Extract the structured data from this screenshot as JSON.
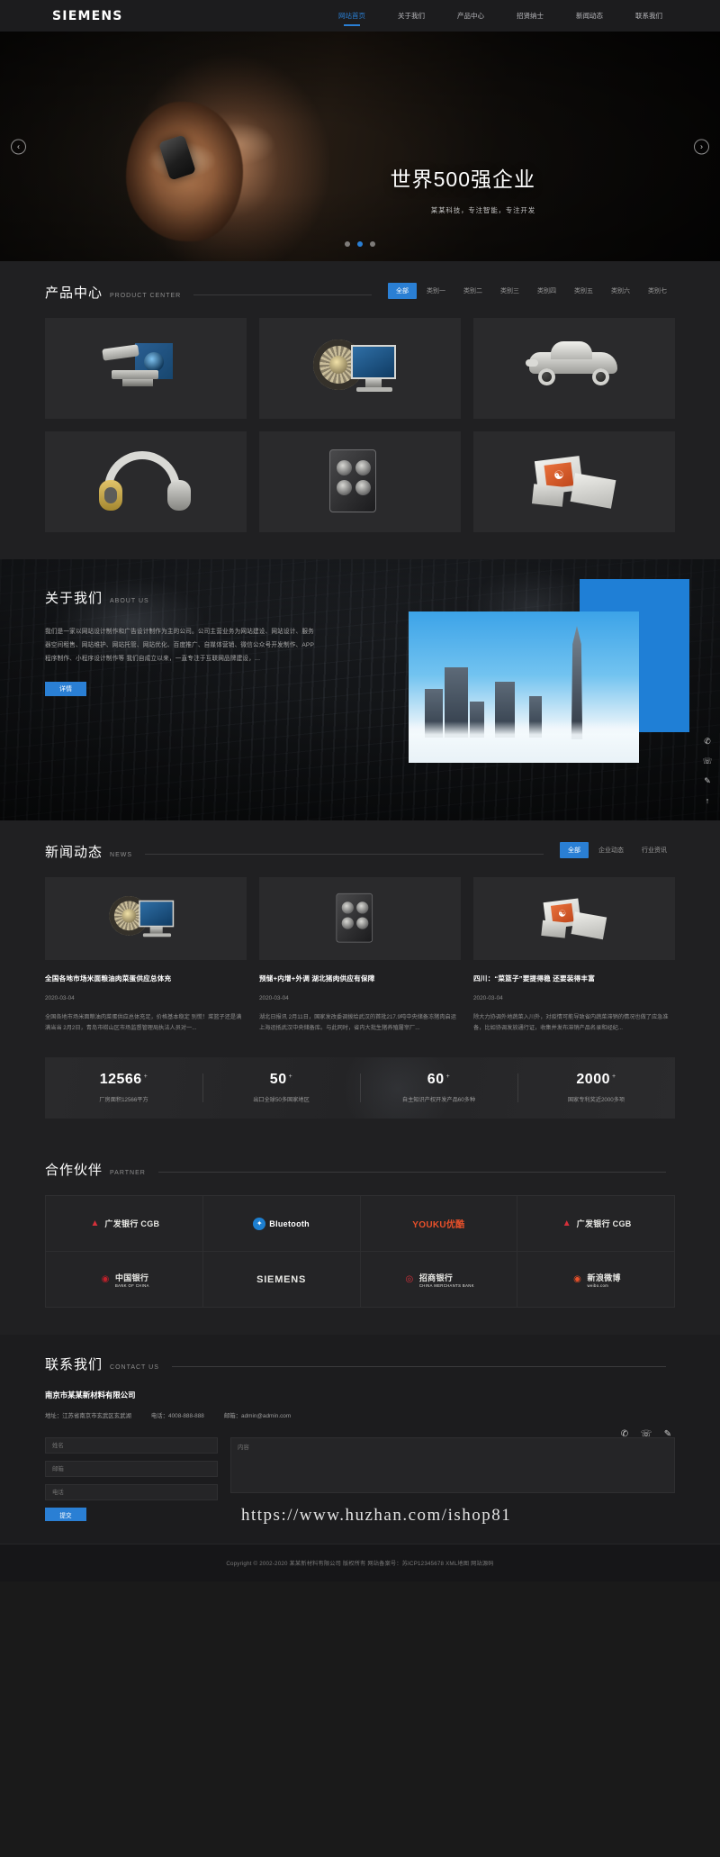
{
  "header": {
    "logo": "SIEMENS",
    "nav": [
      {
        "label": "网站首页",
        "active": true
      },
      {
        "label": "关于我们",
        "active": false
      },
      {
        "label": "产品中心",
        "active": false
      },
      {
        "label": "招贤纳士",
        "active": false
      },
      {
        "label": "新闻动态",
        "active": false
      },
      {
        "label": "联系我们",
        "active": false
      }
    ]
  },
  "banner": {
    "title": "世界500强企业",
    "subtitle": "某某科技，专注智能，专注开发",
    "prev_icon": "chevron-left-icon",
    "next_icon": "chevron-right-icon",
    "dots": 3,
    "active_dot": 1
  },
  "products": {
    "title": "产品中心",
    "title_en": "PRODUCT CENTER",
    "tabs": [
      {
        "label": "全部",
        "active": true
      },
      {
        "label": "类别一",
        "active": false
      },
      {
        "label": "类别二",
        "active": false
      },
      {
        "label": "类别三",
        "active": false
      },
      {
        "label": "类别四",
        "active": false
      },
      {
        "label": "类别五",
        "active": false
      },
      {
        "label": "类别六",
        "active": false
      },
      {
        "label": "类别七",
        "active": false
      }
    ],
    "items": [
      {
        "art": "camera-product"
      },
      {
        "art": "tire-monitor-product"
      },
      {
        "art": "car-product"
      },
      {
        "art": "headphone-product"
      },
      {
        "art": "tower-pc-product"
      },
      {
        "art": "boxes-product"
      }
    ]
  },
  "about": {
    "title": "关于我们",
    "title_en": "ABOUT US",
    "text": "我们是一家以网站设计制作和广告设计制作为主的公司。公司主营业务为网站建设、网站设计、服务器空间租售、网站维护、网站托管、网站优化、百度推广、自媒体营销、微信公众号开发制作、APP程序制作、小程序设计制作等 我们自成立以来，一直专注于互联网品牌建设，...",
    "button": "详情",
    "image_alt": "city-skyline-image"
  },
  "side_icons": [
    {
      "name": "wechat-icon",
      "glyph": "✆"
    },
    {
      "name": "phone-icon",
      "glyph": "☏"
    },
    {
      "name": "message-icon",
      "glyph": "✎"
    },
    {
      "name": "back-to-top-icon",
      "glyph": "↑"
    }
  ],
  "news": {
    "title": "新闻动态",
    "title_en": "NEWS",
    "tabs": [
      {
        "label": "全部",
        "active": true
      },
      {
        "label": "企业动态",
        "active": false
      },
      {
        "label": "行业资讯",
        "active": false
      }
    ],
    "items": [
      {
        "art": "tire-monitor-product",
        "title": "全国各地市场米面粮油肉菜蛋供应总体充",
        "date": "2020-03-04",
        "desc": "全国各地市场米面粮油肉菜蛋供应总体充足，价格基本稳定 别慌！菜篮子还是满满当当 2月2日，青岛市崂山区市场监督管理局执法人员对一..."
      },
      {
        "art": "tower-pc-product",
        "title": "预储+内增+外调 湖北猪肉供应有保障",
        "date": "2020-03-04",
        "desc": "湖北日报讯 2月11日，国家发改委调拨给武汉的首批217.9吨中央储备冻猪肉启运上海运抵武汉中央储备库。与此同时，省内大批生猪养殖屠宰厂..."
      },
      {
        "art": "boxes-product",
        "title": "四川：“菜篮子”要提得稳 还要装得丰富",
        "date": "2020-03-04",
        "desc": "除大力协调外地蔬菜入川外，对疫情可能导致省内蔬菜滞销的情况也做了应急准备，比如协调发放通行证，收集并发布滞销产品名录和经纪..."
      }
    ]
  },
  "stats": [
    {
      "value": "12566",
      "suffix": "+",
      "label": "厂房面积12566平方"
    },
    {
      "value": "50",
      "suffix": "+",
      "label": "出口全球50多国家地区"
    },
    {
      "value": "60",
      "suffix": "+",
      "label": "自主知识产权开发产品60多种"
    },
    {
      "value": "2000",
      "suffix": "+",
      "label": "国家专利奖近2000多项"
    }
  ],
  "partners": {
    "title": "合作伙伴",
    "title_en": "PARTNER",
    "items": [
      {
        "name": "广发银行 CGB",
        "sub": "",
        "mark": "triangle-mark",
        "color": "#d6303a",
        "text_color": "#e8e8e4",
        "icon": "▲"
      },
      {
        "name": "Bluetooth",
        "sub": "®",
        "mark": "bluetooth-mark",
        "color": "#1d7fd0",
        "text_color": "#ffffff",
        "icon": "✦"
      },
      {
        "name": "YOUKU优酷",
        "sub": "",
        "mark": "youku-mark",
        "color": "#e8502a",
        "text_color": "#e8502a",
        "icon": ""
      },
      {
        "name": "广发银行 CGB",
        "sub": "",
        "mark": "triangle-mark",
        "color": "#d6303a",
        "text_color": "#e8e8e4",
        "icon": "▲"
      },
      {
        "name": "中国银行",
        "sub": "BANK OF CHINA",
        "mark": "boc-mark",
        "color": "#c0202a",
        "text_color": "#e8e8e4",
        "icon": "◉"
      },
      {
        "name": "SIEMENS",
        "sub": "",
        "mark": "siemens-mark",
        "color": "#e8e8e4",
        "text_color": "#e8e8e4",
        "icon": ""
      },
      {
        "name": "招商银行",
        "sub": "CHINA MERCHANTS BANK",
        "mark": "cmb-mark",
        "color": "#d6303a",
        "text_color": "#e8e8e4",
        "icon": "◎"
      },
      {
        "name": "新浪微博",
        "sub": "weibo.com",
        "mark": "weibo-mark",
        "color": "#e8502a",
        "text_color": "#e8e8e4",
        "icon": "◉"
      }
    ]
  },
  "contact": {
    "title": "联系我们",
    "title_en": "CONTACT US",
    "company": "南京市某某新材料有限公司",
    "address": "地址：江苏省南京市玄武区玄武湖",
    "phone": "电话：4008-888-888",
    "email": "邮箱：admin@admin.com",
    "social": [
      {
        "name": "wechat-icon",
        "glyph": "✆"
      },
      {
        "name": "phone-icon",
        "glyph": "☏"
      },
      {
        "name": "message-icon",
        "glyph": "✎"
      }
    ],
    "form": {
      "name_placeholder": "姓名",
      "email_placeholder": "邮箱",
      "phone_placeholder": "电话",
      "content_placeholder": "内容",
      "submit_label": "提交"
    }
  },
  "watermark": "https://www.huzhan.com/ishop81",
  "footer": {
    "copyright": "Copyright © 2002-2020 某某新材料有限公司 版权所有 网站备案号：苏ICP12345678 XML地图 网站源码"
  }
}
